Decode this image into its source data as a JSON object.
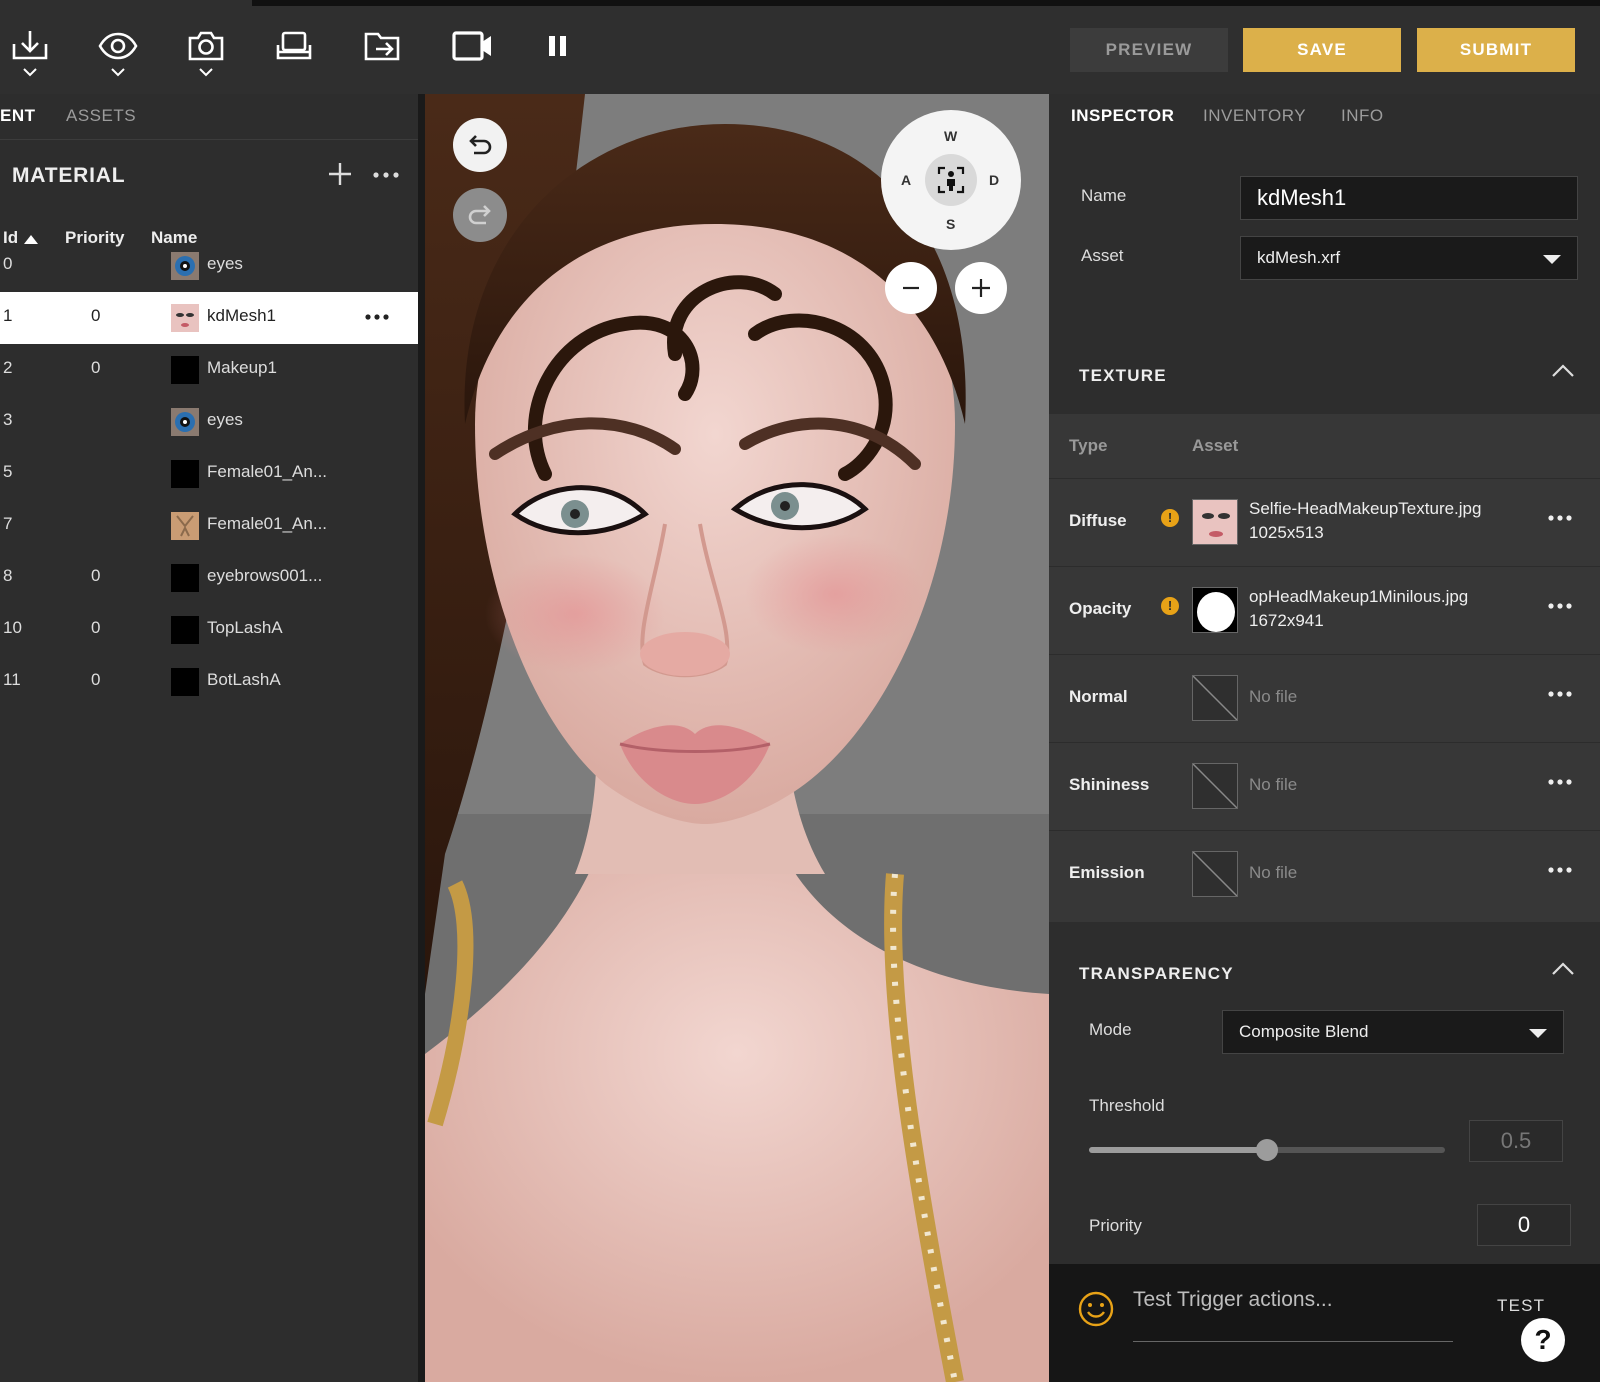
{
  "toolbar": {
    "tools": [
      {
        "icon": "download-icon",
        "has_menu": true
      },
      {
        "icon": "eye-icon",
        "has_menu": true
      },
      {
        "icon": "camera-icon",
        "has_menu": true
      },
      {
        "icon": "seat-icon",
        "has_menu": false
      },
      {
        "icon": "export-folder-icon",
        "has_menu": false
      },
      {
        "icon": "video-camera-icon",
        "has_menu": false
      },
      {
        "icon": "pause-icon",
        "has_menu": false
      }
    ],
    "preview_label": "PREVIEW",
    "save_label": "SAVE",
    "submit_label": "SUBMIT"
  },
  "left": {
    "tabs": [
      "ENT",
      "ASSETS"
    ],
    "section_title": "MATERIAL",
    "columns": {
      "id": "Id",
      "priority": "Priority",
      "name": "Name"
    },
    "sort": "id-ascending",
    "rows": [
      {
        "id": "0",
        "priority": "",
        "name": "eyes",
        "thumb": "eye"
      },
      {
        "id": "1",
        "priority": "0",
        "name": "kdMesh1",
        "thumb": "face",
        "selected": true
      },
      {
        "id": "2",
        "priority": "0",
        "name": "Makeup1",
        "thumb": "black"
      },
      {
        "id": "3",
        "priority": "",
        "name": "eyes",
        "thumb": "eye"
      },
      {
        "id": "5",
        "priority": "",
        "name": "Female01_An...",
        "thumb": "black"
      },
      {
        "id": "7",
        "priority": "",
        "name": "Female01_An...",
        "thumb": "skin"
      },
      {
        "id": "8",
        "priority": "0",
        "name": "eyebrows001...",
        "thumb": "black"
      },
      {
        "id": "10",
        "priority": "0",
        "name": "TopLashA",
        "thumb": "black"
      },
      {
        "id": "11",
        "priority": "0",
        "name": "BotLashA",
        "thumb": "black"
      }
    ]
  },
  "viewport": {
    "compass": {
      "n": "W",
      "w": "A",
      "e": "D",
      "s": "S"
    }
  },
  "inspector": {
    "tabs": [
      "INSPECTOR",
      "INVENTORY",
      "INFO"
    ],
    "name_label": "Name",
    "name_value": "kdMesh1",
    "asset_label": "Asset",
    "asset_value": "kdMesh.xrf",
    "texture_title": "TEXTURE",
    "texture_columns": {
      "type": "Type",
      "asset": "Asset"
    },
    "textures": [
      {
        "type": "Diffuse",
        "warning": true,
        "file": "Selfie-HeadMakeupTexture.jpg",
        "size": "1025x513",
        "thumb": "face"
      },
      {
        "type": "Opacity",
        "warning": true,
        "file": "opHeadMakeup1Minilous.jpg",
        "size": "1672x941",
        "thumb": "white-blob"
      },
      {
        "type": "Normal",
        "warning": false,
        "file": "No file",
        "size": "",
        "thumb": "none"
      },
      {
        "type": "Shininess",
        "warning": false,
        "file": "No file",
        "size": "",
        "thumb": "none"
      },
      {
        "type": "Emission",
        "warning": false,
        "file": "No file",
        "size": "",
        "thumb": "none"
      }
    ],
    "transparency_title": "TRANSPARENCY",
    "mode_label": "Mode",
    "mode_value": "Composite Blend",
    "threshold_label": "Threshold",
    "threshold_value": "0.5",
    "threshold_fraction": 0.5,
    "priority_label": "Priority",
    "priority_value": "0"
  },
  "test_bar": {
    "placeholder": "Test Trigger actions...",
    "test_label": "TEST",
    "help_label": "?"
  },
  "colors": {
    "accent": "#dcb04a",
    "warning": "#e8a217",
    "panel_bg": "#2d2d2d"
  }
}
